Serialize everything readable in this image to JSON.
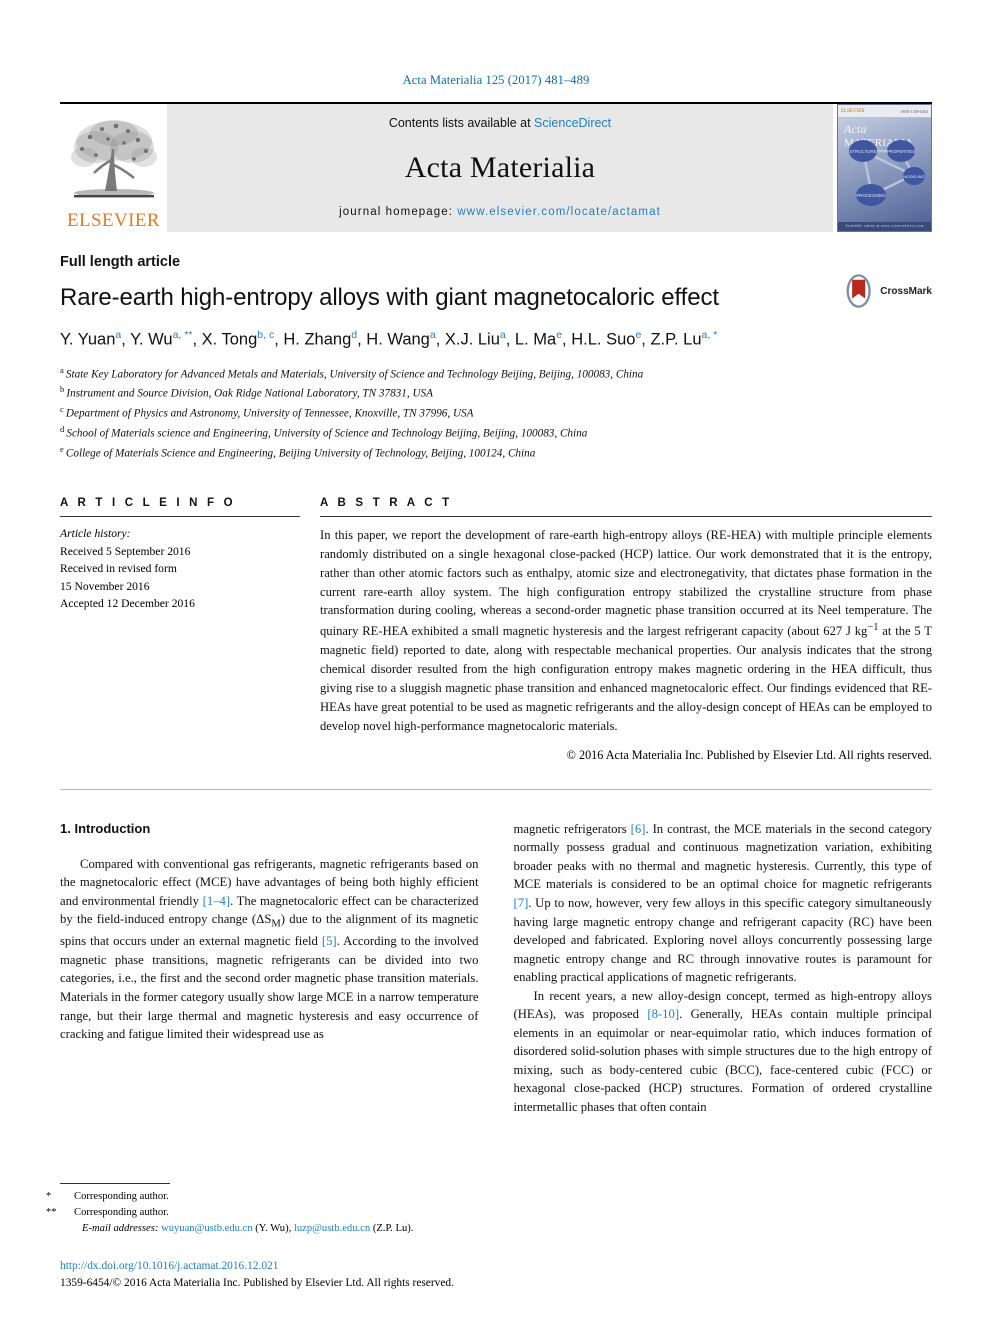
{
  "running_head": "Acta Materialia 125 (2017) 481–489",
  "masthead": {
    "publisher_wordmark": "ELSEVIER",
    "contents_prefix": "Contents lists available at ",
    "contents_link": "ScienceDirect",
    "journal_name": "Acta Materialia",
    "homepage_prefix": "journal homepage: ",
    "homepage_url": "www.elsevier.com/locate/actamat",
    "cover": {
      "title_italic": "Acta",
      "title_rest": "MATERIALIA",
      "publisher_mark": "ELSEVIER",
      "issn_corner": "ISSN 1359-6454",
      "nodes": [
        "STRUCTURE",
        "PROPERTIES",
        "MODELING",
        "PROCESSING"
      ],
      "footer_text": "Available online at www.sciencedirect.com"
    }
  },
  "article": {
    "type": "Full length article",
    "title": "Rare-earth high-entropy alloys with giant magnetocaloric effect",
    "crossmark_label": "CrossMark",
    "authors": [
      {
        "name": "Y. Yuan",
        "sup": "a",
        "sep": ", "
      },
      {
        "name": "Y. Wu",
        "sup": "a, **",
        "sep": ", "
      },
      {
        "name": "X. Tong",
        "sup": "b, c",
        "sep": ", "
      },
      {
        "name": "H. Zhang",
        "sup": "d",
        "sep": ", "
      },
      {
        "name": "H. Wang",
        "sup": "a",
        "sep": ", "
      },
      {
        "name": "X.J. Liu",
        "sup": "a",
        "sep": ", "
      },
      {
        "name": "L. Ma",
        "sup": "e",
        "sep": ", "
      },
      {
        "name": "H.L. Suo",
        "sup": "e",
        "sep": ", "
      },
      {
        "name": "Z.P. Lu",
        "sup": "a, *",
        "sep": ""
      }
    ],
    "affiliations": [
      {
        "key": "a",
        "text": "State Key Laboratory for Advanced Metals and Materials, University of Science and Technology Beijing, Beijing, 100083, China"
      },
      {
        "key": "b",
        "text": "Instrument and Source Division, Oak Ridge National Laboratory, TN 37831, USA"
      },
      {
        "key": "c",
        "text": "Department of Physics and Astronomy, University of Tennessee, Knoxville, TN 37996, USA"
      },
      {
        "key": "d",
        "text": "School of Materials science and Engineering, University of Science and Technology Beijing, Beijing, 100083, China"
      },
      {
        "key": "e",
        "text": "College of Materials Science and Engineering, Beijing University of Technology, Beijing, 100124, China"
      }
    ]
  },
  "article_info": {
    "label": "A R T I C L E   I N F O",
    "history_title": "Article history:",
    "history_lines": [
      "Received 5 September 2016",
      "Received in revised form",
      "15 November 2016",
      "Accepted 12 December 2016"
    ]
  },
  "abstract": {
    "label": "A B S T R A C T",
    "text": "In this paper, we report the development of rare-earth high-entropy alloys (RE-HEA) with multiple principle elements randomly distributed on a single hexagonal close-packed (HCP) lattice. Our work demonstrated that it is the entropy, rather than other atomic factors such as enthalpy, atomic size and electronegativity, that dictates phase formation in the current rare-earth alloy system. The high configuration entropy stabilized the crystalline structure from phase transformation during cooling, whereas a second-order magnetic phase transition occurred at its Neel temperature. The quinary RE-HEA exhibited a small magnetic hysteresis and the largest refrigerant capacity (about 627 J kg",
    "superscript": "−1",
    "text2": " at the 5 T magnetic field) reported to date, along with respectable mechanical properties. Our analysis indicates that the strong chemical disorder resulted from the high configuration entropy makes magnetic ordering in the HEA difficult, thus giving rise to a sluggish magnetic phase transition and enhanced magnetocaloric effect. Our findings evidenced that RE-HEAs have great potential to be used as magnetic refrigerants and the alloy-design concept of HEAs can be employed to develop novel high-performance magnetocaloric materials.",
    "copyright": "© 2016 Acta Materialia Inc. Published by Elsevier Ltd. All rights reserved."
  },
  "introduction": {
    "heading": "1. Introduction",
    "left_p1_a": "Compared with conventional gas refrigerants, magnetic refrigerants based on the magnetocaloric effect (MCE) have advantages of being both highly efficient and environmental friendly ",
    "left_cite_1": "[1–4]",
    "left_p1_b": ". The magnetocaloric effect can be characterized by the field-induced entropy change (ΔS",
    "left_sub_m": "M",
    "left_p1_c": ") due to the alignment of its magnetic spins that occurs under an external magnetic field ",
    "left_cite_2": "[5]",
    "left_p1_d": ". According to the involved magnetic phase transitions, magnetic refrigerants can be divided into two categories, i.e., the first and the second order magnetic phase transition materials. Materials in the former category usually show large MCE in a narrow temperature range, but their large thermal and magnetic hysteresis and easy occurrence of cracking and fatigue limited their widespread use as",
    "right_p1_a": "magnetic refrigerators ",
    "right_cite_1": "[6]",
    "right_p1_b": ". In contrast, the MCE materials in the second category normally possess gradual and continuous magnetization variation, exhibiting broader peaks with no thermal and magnetic hysteresis. Currently, this type of MCE materials is considered to be an optimal choice for magnetic refrigerants ",
    "right_cite_2": "[7]",
    "right_p1_c": ". Up to now, however, very few alloys in this specific category simultaneously having large magnetic entropy change and refrigerant capacity (RC) have been developed and fabricated. Exploring novel alloys concurrently possessing large magnetic entropy change and RC through innovative routes is paramount for enabling practical applications of magnetic refrigerants.",
    "right_p2_a": "In recent years, a new alloy-design concept, termed as high-entropy alloys (HEAs), was proposed ",
    "right_cite_3": "[8-10]",
    "right_p2_b": ". Generally, HEAs contain multiple principal elements in an equimolar or near-equimolar ratio, which induces formation of disordered solid-solution phases with simple structures due to the high entropy of mixing, such as body-centered cubic (BCC), face-centered cubic (FCC) or hexagonal close-packed (HCP) structures. Formation of ordered crystalline intermetallic phases that often contain"
  },
  "footnotes": {
    "star_single": "*",
    "star_double": "**",
    "corresponding_1": "Corresponding author.",
    "corresponding_2": "Corresponding author.",
    "email_label": "E-mail addresses:",
    "email_1": "wuyuan@ustb.edu.cn",
    "email_1_owner": "(Y. Wu)",
    "email_2": "luzp@ustb.edu.cn",
    "email_2_owner": "(Z.P. Lu)"
  },
  "footer": {
    "doi": "http://dx.doi.org/10.1016/j.actamat.2016.12.021",
    "issn_line": "1359-6454/© 2016 Acta Materialia Inc. Published by Elsevier Ltd. All rights reserved."
  },
  "colors": {
    "link": "#1f7ec4",
    "running_head": "#0a6ea8",
    "elsevier_orange": "#e87a1e",
    "band_gray": "#e8e8e8"
  }
}
